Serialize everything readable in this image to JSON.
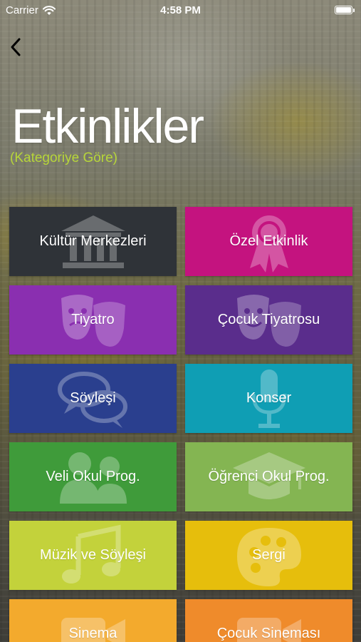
{
  "status_bar": {
    "carrier": "Carrier",
    "time": "4:58 PM"
  },
  "header": {
    "title": "Etkinlikler",
    "subtitle": "(Kategoriye Göre)"
  },
  "colors": {
    "subtitle": "#b7d63a",
    "kultur": "#2f3338",
    "ozel": "#c4137f",
    "tiyatro": "#8a2fb0",
    "cocuk_tiyatro": "#5a2d8c",
    "soylesi": "#2a3f8e",
    "konser": "#0f9eb4",
    "veli": "#3f9b3a",
    "ogrenci": "#84b552",
    "muzik": "#c3d23b",
    "sergi": "#e6be0c",
    "sinema": "#f3aa2d",
    "cocuk_sinema": "#ef8b2b"
  },
  "categories": [
    {
      "label": "Kültür Merkezleri",
      "icon": "museum-icon"
    },
    {
      "label": "Özel Etkinlik",
      "icon": "award-ribbon-icon"
    },
    {
      "label": "Tiyatro",
      "icon": "theater-masks-icon"
    },
    {
      "label": "Çocuk Tiyatrosu",
      "icon": "theater-masks-icon"
    },
    {
      "label": "Söyleşi",
      "icon": "chat-bubbles-icon"
    },
    {
      "label": "Konser",
      "icon": "microphone-icon"
    },
    {
      "label": "Veli Okul Prog.",
      "icon": "users-icon"
    },
    {
      "label": "Öğrenci Okul Prog.",
      "icon": "graduation-cap-icon"
    },
    {
      "label": "Müzik ve Söyleşi",
      "icon": "music-notes-icon"
    },
    {
      "label": "Sergi",
      "icon": "palette-icon"
    },
    {
      "label": "Sinema",
      "icon": "film-camera-icon"
    },
    {
      "label": "Çocuk Sineması",
      "icon": "film-camera-icon"
    }
  ]
}
